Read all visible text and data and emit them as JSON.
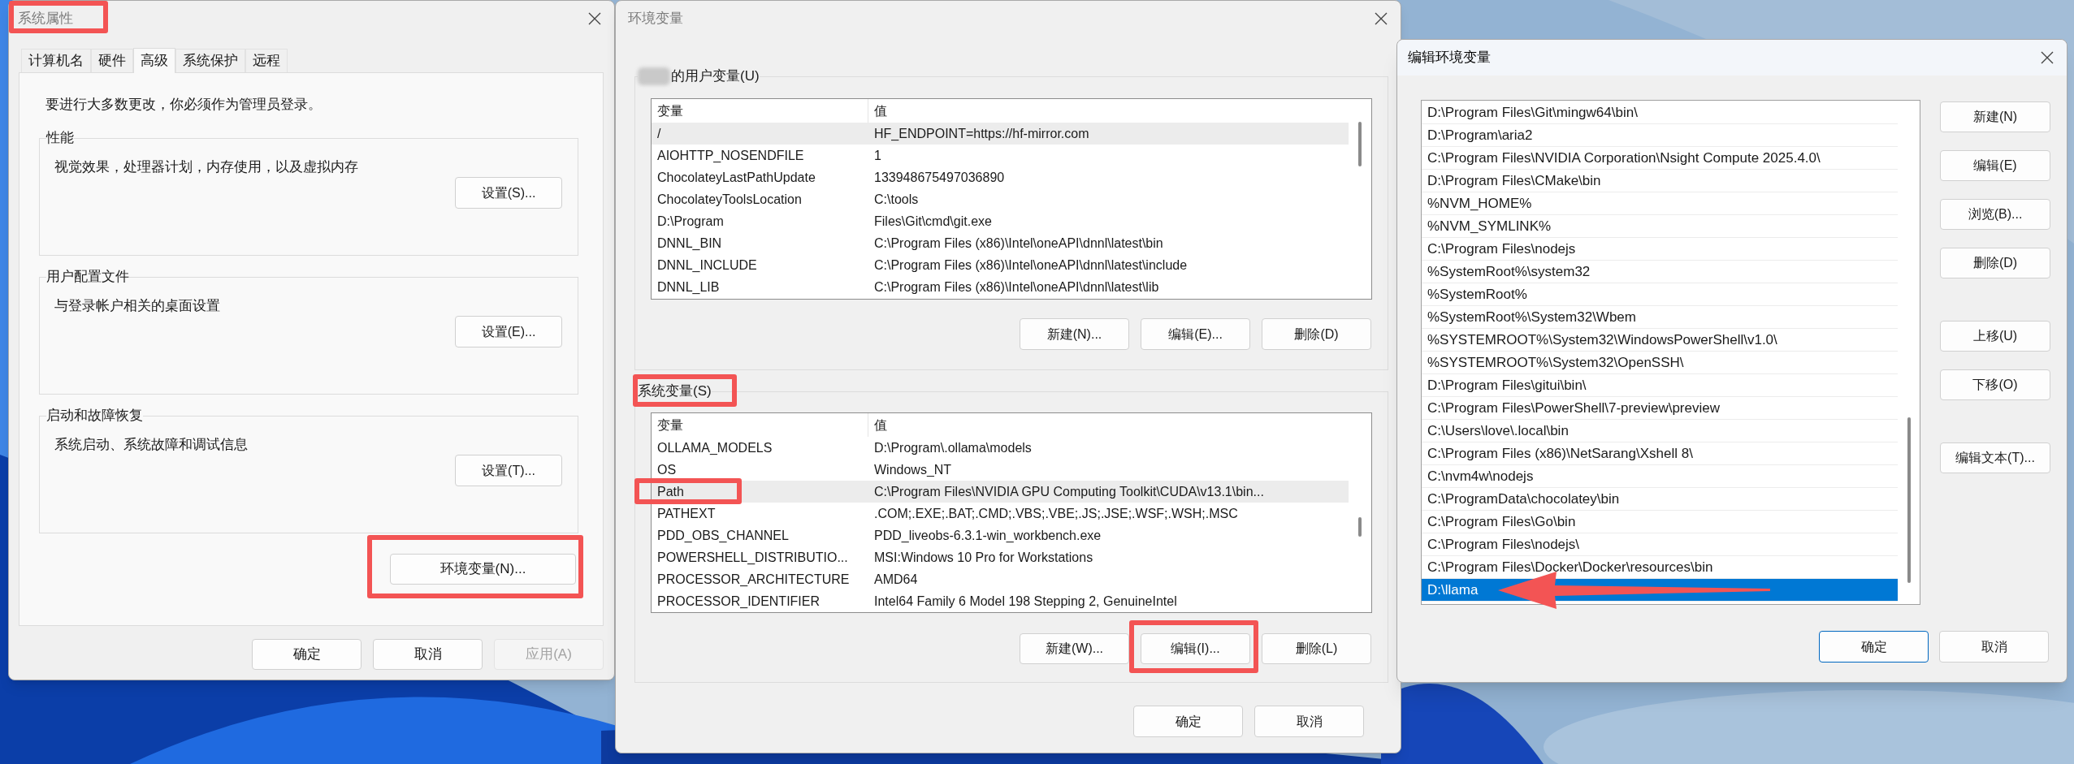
{
  "system_properties": {
    "title": "系统属性",
    "active": false,
    "title_highlighted": true,
    "tabs": [
      {
        "label": "计算机名",
        "selected": false
      },
      {
        "label": "硬件",
        "selected": false
      },
      {
        "label": "高级",
        "selected": true
      },
      {
        "label": "系统保护",
        "selected": false
      },
      {
        "label": "远程",
        "selected": false
      }
    ],
    "notice": "要进行大多数更改，你必须作为管理员登录。",
    "groups": [
      {
        "heading": "性能",
        "description": "视觉效果，处理器计划，内存使用，以及虚拟内存",
        "button": "设置(S)..."
      },
      {
        "heading": "用户配置文件",
        "description": "与登录帐户相关的桌面设置",
        "button": "设置(E)..."
      },
      {
        "heading": "启动和故障恢复",
        "description": "系统启动、系统故障和调试信息",
        "button": "设置(T)..."
      }
    ],
    "env_button": {
      "label": "环境变量(N)...",
      "highlighted": true
    },
    "buttons": [
      {
        "label": "确定",
        "disabled": false
      },
      {
        "label": "取消",
        "disabled": false
      },
      {
        "label": "应用(A)",
        "disabled": true
      }
    ]
  },
  "environment_variables": {
    "title": "环境变量",
    "active": false,
    "user_section": {
      "heading": "的用户变量(U)",
      "highlighted": false,
      "columns": [
        "变量",
        "值"
      ],
      "rows": [
        {
          "name": "/",
          "value": "HF_ENDPOINT=https://hf-mirror.com",
          "selected": true,
          "highlighted": false
        },
        {
          "name": "AIOHTTP_NOSENDFILE",
          "value": "1",
          "selected": false,
          "highlighted": false
        },
        {
          "name": "ChocolateyLastPathUpdate",
          "value": "133948675497036890",
          "selected": false,
          "highlighted": false
        },
        {
          "name": "ChocolateyToolsLocation",
          "value": "C:\\tools",
          "selected": false,
          "highlighted": false
        },
        {
          "name": "D:\\Program",
          "value": "Files\\Git\\cmd\\git.exe",
          "selected": false,
          "highlighted": false
        },
        {
          "name": "DNNL_BIN",
          "value": "C:\\Program Files (x86)\\Intel\\oneAPI\\dnnl\\latest\\bin",
          "selected": false,
          "highlighted": false
        },
        {
          "name": "DNNL_INCLUDE",
          "value": "C:\\Program Files (x86)\\Intel\\oneAPI\\dnnl\\latest\\include",
          "selected": false,
          "highlighted": false
        },
        {
          "name": "DNNL_LIB",
          "value": "C:\\Program Files (x86)\\Intel\\oneAPI\\dnnl\\latest\\lib",
          "selected": false,
          "highlighted": false
        }
      ],
      "buttons": [
        {
          "label": "新建(N)...",
          "highlighted": false
        },
        {
          "label": "编辑(E)...",
          "highlighted": false
        },
        {
          "label": "删除(D)",
          "highlighted": false
        }
      ]
    },
    "system_section": {
      "heading": "系统变量(S)",
      "highlighted": true,
      "columns": [
        "变量",
        "值"
      ],
      "rows": [
        {
          "name": "OLLAMA_MODELS",
          "value": "D:\\Program\\.ollama\\models",
          "selected": false,
          "highlighted": false
        },
        {
          "name": "OS",
          "value": "Windows_NT",
          "selected": false,
          "highlighted": false
        },
        {
          "name": "Path",
          "value": "C:\\Program Files\\NVIDIA GPU Computing Toolkit\\CUDA\\v13.1\\bin...",
          "selected": true,
          "highlighted": true
        },
        {
          "name": "PATHEXT",
          "value": ".COM;.EXE;.BAT;.CMD;.VBS;.VBE;.JS;.JSE;.WSF;.WSH;.MSC",
          "selected": false,
          "highlighted": false
        },
        {
          "name": "PDD_OBS_CHANNEL",
          "value": "PDD_liveobs-6.3.1-win_workbench.exe",
          "selected": false,
          "highlighted": false
        },
        {
          "name": "POWERSHELL_DISTRIBUTIO...",
          "value": "MSI:Windows 10 Pro for Workstations",
          "selected": false,
          "highlighted": false
        },
        {
          "name": "PROCESSOR_ARCHITECTURE",
          "value": "AMD64",
          "selected": false,
          "highlighted": false
        },
        {
          "name": "PROCESSOR_IDENTIFIER",
          "value": "Intel64 Family 6 Model 198 Stepping 2, GenuineIntel",
          "selected": false,
          "highlighted": false
        }
      ],
      "buttons": [
        {
          "label": "新建(W)...",
          "highlighted": false
        },
        {
          "label": "编辑(I)...",
          "highlighted": true
        },
        {
          "label": "删除(L)",
          "highlighted": false
        }
      ]
    },
    "buttons": [
      {
        "label": "确定"
      },
      {
        "label": "取消"
      }
    ]
  },
  "edit_environment_variable": {
    "title": "编辑环境变量",
    "active": true,
    "entries": [
      {
        "text": "D:\\Program Files\\Git\\mingw64\\bin\\",
        "selected": false,
        "arrow": false
      },
      {
        "text": "D:\\Program\\aria2",
        "selected": false,
        "arrow": false
      },
      {
        "text": "C:\\Program Files\\NVIDIA Corporation\\Nsight Compute 2025.4.0\\",
        "selected": false,
        "arrow": false
      },
      {
        "text": "D:\\Program Files\\CMake\\bin",
        "selected": false,
        "arrow": false
      },
      {
        "text": "%NVM_HOME%",
        "selected": false,
        "arrow": false
      },
      {
        "text": "%NVM_SYMLINK%",
        "selected": false,
        "arrow": false
      },
      {
        "text": "C:\\Program Files\\nodejs",
        "selected": false,
        "arrow": false
      },
      {
        "text": "%SystemRoot%\\system32",
        "selected": false,
        "arrow": false
      },
      {
        "text": "%SystemRoot%",
        "selected": false,
        "arrow": false
      },
      {
        "text": "%SystemRoot%\\System32\\Wbem",
        "selected": false,
        "arrow": false
      },
      {
        "text": "%SYSTEMROOT%\\System32\\WindowsPowerShell\\v1.0\\",
        "selected": false,
        "arrow": false
      },
      {
        "text": "%SYSTEMROOT%\\System32\\OpenSSH\\",
        "selected": false,
        "arrow": false
      },
      {
        "text": "D:\\Program Files\\gitui\\bin\\",
        "selected": false,
        "arrow": false
      },
      {
        "text": "C:\\Program Files\\PowerShell\\7-preview\\preview",
        "selected": false,
        "arrow": false
      },
      {
        "text": "C:\\Users\\love\\.local\\bin",
        "selected": false,
        "arrow": false
      },
      {
        "text": "C:\\Program Files (x86)\\NetSarang\\Xshell 8\\",
        "selected": false,
        "arrow": false
      },
      {
        "text": "C:\\nvm4w\\nodejs",
        "selected": false,
        "arrow": false
      },
      {
        "text": "C:\\ProgramData\\chocolatey\\bin",
        "selected": false,
        "arrow": false
      },
      {
        "text": "C:\\Program Files\\Go\\bin",
        "selected": false,
        "arrow": false
      },
      {
        "text": "C:\\Program Files\\nodejs\\",
        "selected": false,
        "arrow": false
      },
      {
        "text": "C:\\Program Files\\Docker\\Docker\\resources\\bin",
        "selected": false,
        "arrow": false
      },
      {
        "text": "D:\\llama",
        "selected": true,
        "arrow": true
      }
    ],
    "side_button_groups": [
      [
        "新建(N)",
        "编辑(E)",
        "浏览(B)...",
        "删除(D)"
      ],
      [
        "上移(U)",
        "下移(O)"
      ],
      [
        "编辑文本(T)..."
      ]
    ],
    "buttons": [
      {
        "label": "确定",
        "default": true
      },
      {
        "label": "取消",
        "default": false
      }
    ]
  }
}
